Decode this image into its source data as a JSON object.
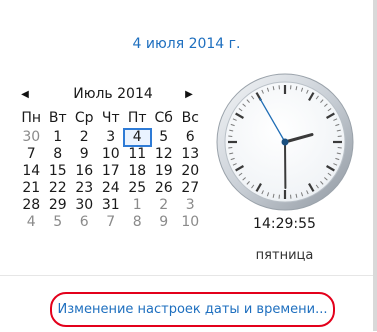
{
  "header": {
    "date_text": "4 июля 2014 г."
  },
  "calendar": {
    "month_label": "Июль 2014",
    "prev_icon": "triangle-left-icon",
    "next_icon": "triangle-right-icon",
    "weekdays": [
      "Пн",
      "Вт",
      "Ср",
      "Чт",
      "Пт",
      "Сб",
      "Вс"
    ],
    "days": [
      {
        "d": "30",
        "other": true
      },
      {
        "d": "1"
      },
      {
        "d": "2"
      },
      {
        "d": "3"
      },
      {
        "d": "4",
        "today": true
      },
      {
        "d": "5"
      },
      {
        "d": "6"
      },
      {
        "d": "7"
      },
      {
        "d": "8"
      },
      {
        "d": "9"
      },
      {
        "d": "10"
      },
      {
        "d": "11"
      },
      {
        "d": "12"
      },
      {
        "d": "13"
      },
      {
        "d": "14"
      },
      {
        "d": "15"
      },
      {
        "d": "16"
      },
      {
        "d": "17"
      },
      {
        "d": "18"
      },
      {
        "d": "19"
      },
      {
        "d": "20"
      },
      {
        "d": "21"
      },
      {
        "d": "22"
      },
      {
        "d": "23"
      },
      {
        "d": "24"
      },
      {
        "d": "25"
      },
      {
        "d": "26"
      },
      {
        "d": "27"
      },
      {
        "d": "28"
      },
      {
        "d": "29"
      },
      {
        "d": "30"
      },
      {
        "d": "31"
      },
      {
        "d": "1",
        "other": true
      },
      {
        "d": "2",
        "other": true
      },
      {
        "d": "3",
        "other": true
      },
      {
        "d": "4",
        "other": true
      },
      {
        "d": "5",
        "other": true
      },
      {
        "d": "6",
        "other": true
      },
      {
        "d": "7",
        "other": true
      },
      {
        "d": "8",
        "other": true
      },
      {
        "d": "9",
        "other": true
      },
      {
        "d": "10",
        "other": true
      }
    ]
  },
  "clock": {
    "time": "14:29:55",
    "weekday": "пятница",
    "hours": 14,
    "minutes": 29,
    "seconds": 55
  },
  "footer": {
    "settings_link": "Изменение настроек даты и времени..."
  },
  "colors": {
    "link": "#1e6fbf",
    "highlight_ring": "#e3001b",
    "today_border": "#2e7bd6",
    "second_hand": "#1f6db5"
  }
}
